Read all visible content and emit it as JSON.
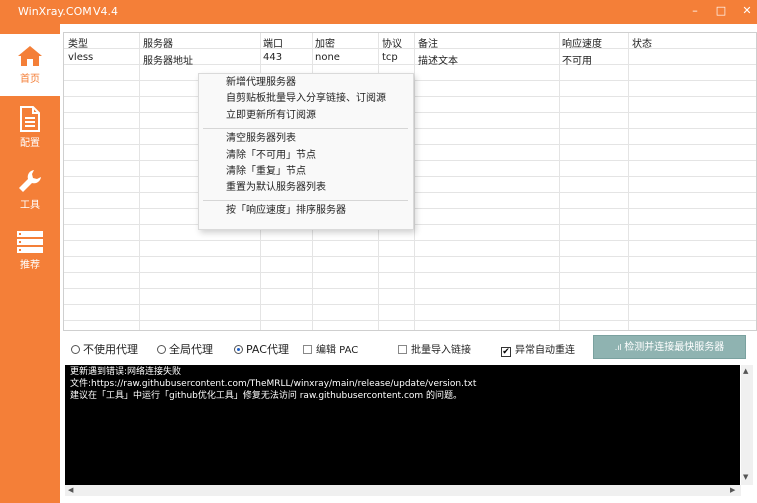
{
  "window": {
    "title": "WinXray.COM",
    "version": "V4.4",
    "controls": [
      "–",
      "□",
      "✕"
    ]
  },
  "sidebar": {
    "items": [
      {
        "label": "首页",
        "icon": "home-icon",
        "active": true
      },
      {
        "label": "配置",
        "icon": "document-icon",
        "active": false
      },
      {
        "label": "工具",
        "icon": "wrench-icon",
        "active": false
      },
      {
        "label": "推荐",
        "icon": "server-icon",
        "active": false
      }
    ]
  },
  "server_table": {
    "columns": [
      "类型",
      "服务器",
      "端口",
      "加密",
      "协议",
      "备注",
      "响应速度",
      "状态"
    ],
    "rows": [
      [
        "vless",
        "服务器地址",
        "443",
        "none",
        "tcp",
        "描述文本",
        "不可用",
        ""
      ]
    ]
  },
  "context_menu": {
    "groups": [
      [
        "新增代理服务器",
        "自剪贴板批量导入分享链接、订阅源",
        "立即更新所有订阅源"
      ],
      [
        "清空服务器列表",
        "清除「不可用」节点",
        "清除「重复」节点",
        "重置为默认服务器列表"
      ],
      [
        "按「响应速度」排序服务器"
      ]
    ]
  },
  "options": {
    "no_proxy": "不使用代理",
    "global_proxy": "全局代理",
    "pac_proxy": "PAC代理",
    "selected": "pac_proxy",
    "edit_pac": "编辑 PAC",
    "batch_import": "批量导入链接",
    "auto_reconnect": "异常自动重连",
    "auto_reconnect_checked": true,
    "speed_test_button": "检测并连接最快服务器"
  },
  "log": {
    "lines": [
      "更新遇到错误:网络连接失败",
      "文件:https://raw.githubusercontent.com/TheMRLL/winxray/main/release/update/version.txt",
      "建议在「工具」中运行「github优化工具」修复无法访问 raw.githubusercontent.com 的问题。"
    ]
  },
  "colors": {
    "accent": "#f47f38",
    "button": "#8fb3b1",
    "log_bg": "#000000"
  }
}
